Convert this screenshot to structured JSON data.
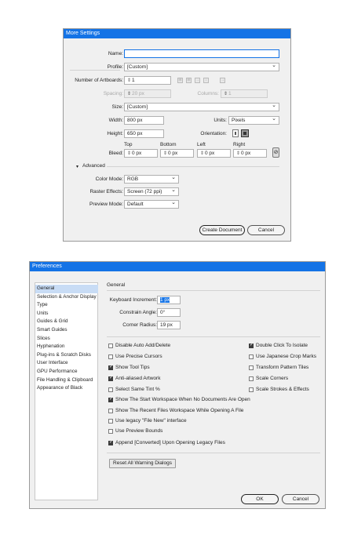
{
  "more_settings": {
    "title": "More Settings",
    "name": {
      "label": "Name:",
      "value": ""
    },
    "profile": {
      "label": "Profile:",
      "value": "[Custom]"
    },
    "artboards": {
      "label": "Number of Artboards:",
      "value": "1"
    },
    "spacing": {
      "label": "Spacing:",
      "value": "20 px"
    },
    "columns": {
      "label": "Columns:",
      "value": "1"
    },
    "size": {
      "label": "Size:",
      "value": "[Custom]"
    },
    "width": {
      "label": "Width:",
      "value": "800 px"
    },
    "units": {
      "label": "Units:",
      "value": "Pixels"
    },
    "height": {
      "label": "Height:",
      "value": "650 px"
    },
    "orientation": {
      "label": "Orientation:"
    },
    "bleed": {
      "label": "Bleed:",
      "top_label": "Top",
      "top_value": "0 px",
      "bottom_label": "Bottom",
      "bottom_value": "0 px",
      "left_label": "Left",
      "left_value": "0 px",
      "right_label": "Right",
      "right_value": "0 px"
    },
    "advanced_label": "Advanced",
    "color_mode": {
      "label": "Color Mode:",
      "value": "RGB"
    },
    "raster_effects": {
      "label": "Raster Effects:",
      "value": "Screen (72 ppi)"
    },
    "preview_mode": {
      "label": "Preview Mode:",
      "value": "Default"
    },
    "create_button": "Create Document",
    "cancel_button": "Cancel"
  },
  "preferences": {
    "title": "Preferences",
    "nav": [
      {
        "label": "General",
        "active": true
      },
      {
        "label": "Selection & Anchor Display",
        "active": false
      },
      {
        "label": "Type",
        "active": false
      },
      {
        "label": "Units",
        "active": false
      },
      {
        "label": "Guides & Grid",
        "active": false
      },
      {
        "label": "Smart Guides",
        "active": false
      },
      {
        "label": "Slices",
        "active": false
      },
      {
        "label": "Hyphenation",
        "active": false
      },
      {
        "label": "Plug-ins & Scratch Disks",
        "active": false
      },
      {
        "label": "User Interface",
        "active": false
      },
      {
        "label": "GPU Performance",
        "active": false
      },
      {
        "label": "File Handling & Clipboard",
        "active": false
      },
      {
        "label": "Appearance of Black",
        "active": false
      }
    ],
    "section_title": "General",
    "keyboard_increment": {
      "label": "Keyboard Increment:",
      "value": "1 px"
    },
    "constrain_angle": {
      "label": "Constrain Angle:",
      "value": "0°"
    },
    "corner_radius": {
      "label": "Corner Radius:",
      "value": "19 px"
    },
    "left_options": [
      {
        "label": "Disable Auto Add/Delete",
        "checked": false
      },
      {
        "label": "Use Precise Cursors",
        "checked": false
      },
      {
        "label": "Show Tool Tips",
        "checked": true
      },
      {
        "label": "Anti-aliased Artwork",
        "checked": true
      },
      {
        "label": "Select Same Tint %",
        "checked": false
      },
      {
        "label": "Show The Start Workspace When No Documents Are Open",
        "checked": true
      },
      {
        "label": "Show The Recent Files Workspace While Opening A File",
        "checked": false
      },
      {
        "label": "Use legacy \"File New\" interface",
        "checked": false
      },
      {
        "label": "Use Preview Bounds",
        "checked": false
      },
      {
        "label": "Append [Converted] Upon Opening Legacy Files",
        "checked": true
      }
    ],
    "right_options": [
      {
        "label": "Double Click To Isolate",
        "checked": true
      },
      {
        "label": "Use Japanese Crop Marks",
        "checked": false
      },
      {
        "label": "Transform Pattern Tiles",
        "checked": false
      },
      {
        "label": "Scale Corners",
        "checked": false
      },
      {
        "label": "Scale Strokes & Effects",
        "checked": false
      }
    ],
    "reset_button": "Reset All Warning Dialogs",
    "ok_button": "OK",
    "cancel_button": "Cancel"
  }
}
